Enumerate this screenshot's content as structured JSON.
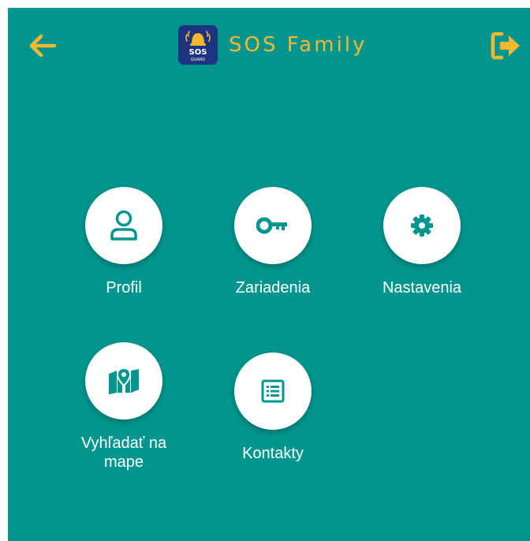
{
  "header": {
    "title": "SOS Family",
    "logo_text": "SOS",
    "logo_subtext": "GUARD",
    "back_icon": "arrow-left-icon",
    "logout_icon": "logout-icon",
    "accent_color": "#f5b82e"
  },
  "colors": {
    "background": "#00968f",
    "icon": "#00968f",
    "label": "#ffffff"
  },
  "menu": {
    "items": [
      {
        "label": "Profil",
        "icon": "user-icon"
      },
      {
        "label": "Zariadenia",
        "icon": "key-icon"
      },
      {
        "label": "Nastavenia",
        "icon": "gear-icon"
      },
      {
        "label": "Vyhľadať na mape",
        "icon": "map-icon"
      },
      {
        "label": "Kontakty",
        "icon": "contacts-list-icon"
      }
    ]
  }
}
